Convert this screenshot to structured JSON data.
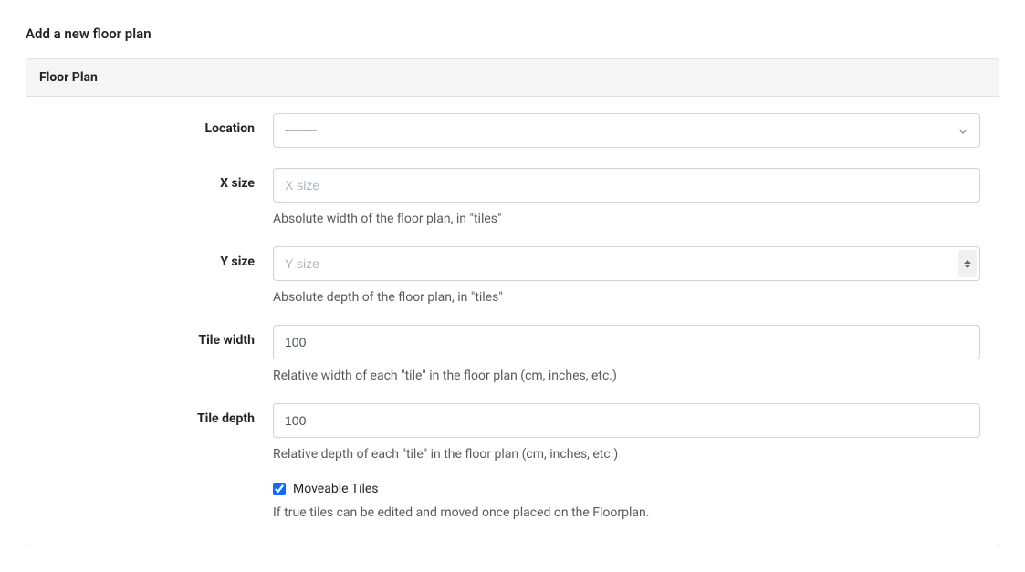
{
  "page": {
    "title": "Add a new floor plan"
  },
  "panel": {
    "header": "Floor Plan"
  },
  "fields": {
    "location": {
      "label": "Location",
      "value": "---------"
    },
    "xsize": {
      "label": "X size",
      "placeholder": "X size",
      "value": "",
      "help": "Absolute width of the floor plan, in \"tiles\""
    },
    "ysize": {
      "label": "Y size",
      "placeholder": "Y size",
      "value": "",
      "help": "Absolute depth of the floor plan, in \"tiles\""
    },
    "tilewidth": {
      "label": "Tile width",
      "value": "100",
      "help": "Relative width of each \"tile\" in the floor plan (cm, inches, etc.)"
    },
    "tiledepth": {
      "label": "Tile depth",
      "value": "100",
      "help": "Relative depth of each \"tile\" in the floor plan (cm, inches, etc.)"
    },
    "moveable": {
      "label": "Moveable Tiles",
      "checked": true,
      "help": "If true tiles can be edited and moved once placed on the Floorplan."
    }
  }
}
